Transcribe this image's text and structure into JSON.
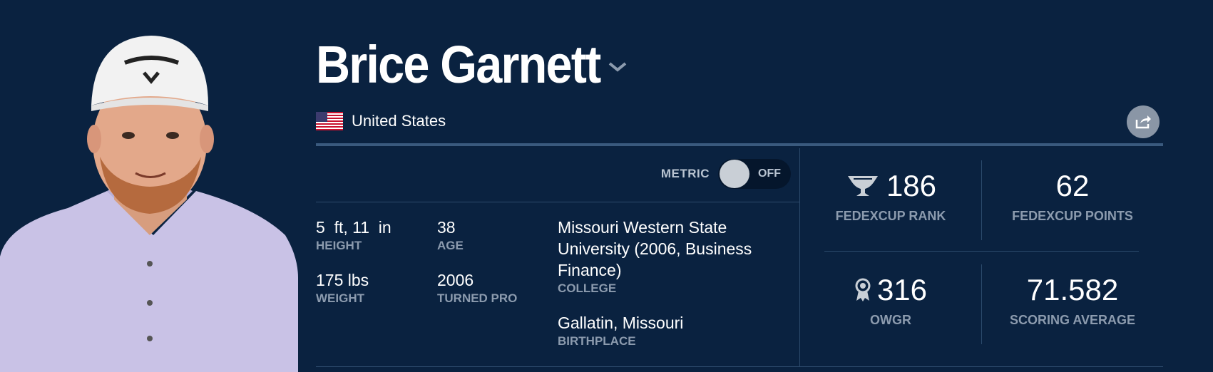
{
  "player": {
    "name": "Brice Garnett",
    "country": "United States"
  },
  "metric_toggle": {
    "label": "METRIC",
    "state": "OFF"
  },
  "bio": {
    "height": {
      "value": "5  ft, 11  in",
      "label": "HEIGHT"
    },
    "age": {
      "value": "38",
      "label": "AGE"
    },
    "weight": {
      "value": "175 lbs",
      "label": "WEIGHT"
    },
    "turned_pro": {
      "value": "2006",
      "label": "TURNED PRO"
    },
    "college": {
      "value_line1": "Missouri Western State",
      "value_line2": "University (2006, Business",
      "value_line3": "Finance)",
      "label": "COLLEGE"
    },
    "birthplace": {
      "value": "Gallatin, Missouri",
      "label": "BIRTHPLACE"
    }
  },
  "stats": {
    "fedexcup_rank": {
      "value": "186",
      "label": "FEDEXCUP RANK",
      "icon": "trophy-icon"
    },
    "fedexcup_points": {
      "value": "62",
      "label": "FEDEXCUP POINTS"
    },
    "owgr": {
      "value": "316",
      "label": "OWGR",
      "icon": "award-ribbon-icon"
    },
    "scoring_average": {
      "value": "71.582",
      "label": "SCORING AVERAGE"
    }
  },
  "colors": {
    "background": "#0a2240",
    "divider": "#2c4a6c",
    "label": "#8c9bae",
    "share_button": "#8a96a6"
  }
}
